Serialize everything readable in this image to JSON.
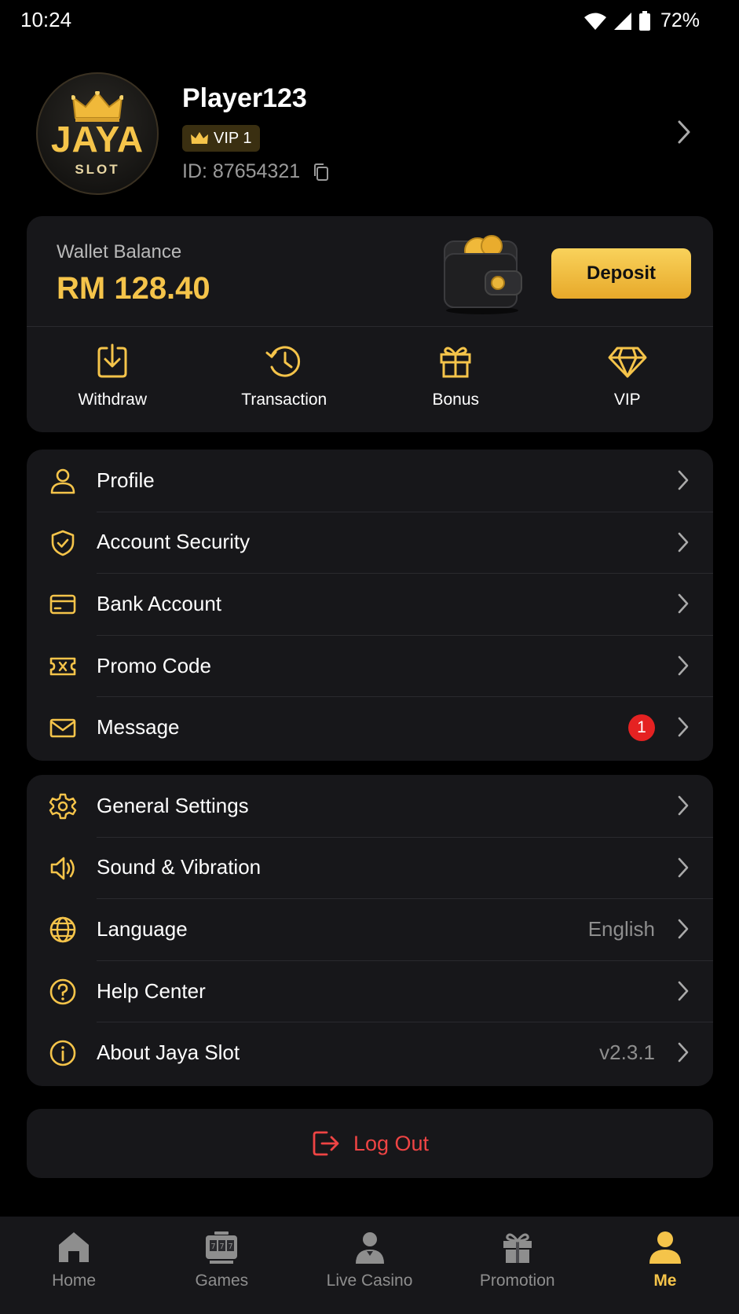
{
  "status_bar": {
    "time": "10:24",
    "battery": "72%"
  },
  "profile": {
    "logo_title": "JAYA",
    "logo_subtitle": "SLOT",
    "name": "Player123",
    "vip_level": "VIP 1",
    "id_text": "ID: 87654321"
  },
  "wallet": {
    "label": "Wallet Balance",
    "balance": "RM 128.40",
    "deposit_label": "Deposit",
    "actions": [
      {
        "label": "Withdraw",
        "icon": "withdraw-icon"
      },
      {
        "label": "Transaction",
        "icon": "history-icon"
      },
      {
        "label": "Bonus",
        "icon": "gift-icon"
      },
      {
        "label": "VIP",
        "icon": "diamond-icon"
      }
    ]
  },
  "menu_account": [
    {
      "label": "Profile",
      "icon": "user-icon"
    },
    {
      "label": "Account Security",
      "icon": "shield-icon"
    },
    {
      "label": "Bank Account",
      "icon": "card-icon"
    },
    {
      "label": "Promo Code",
      "icon": "ticket-icon"
    },
    {
      "label": "Message",
      "icon": "mail-icon",
      "badge": "1"
    }
  ],
  "menu_settings": [
    {
      "label": "General Settings",
      "icon": "gear-icon"
    },
    {
      "label": "Sound & Vibration",
      "icon": "speaker-icon"
    },
    {
      "label": "Language",
      "icon": "globe-icon",
      "value": "English"
    },
    {
      "label": "Help Center",
      "icon": "question-icon"
    },
    {
      "label": "About Jaya Slot",
      "icon": "info-icon",
      "value": "v2.3.1"
    }
  ],
  "logout_label": "Log Out",
  "bottom_nav": [
    {
      "label": "Home",
      "icon": "home-icon",
      "active": false
    },
    {
      "label": "Games",
      "icon": "slot-machine-icon",
      "active": false
    },
    {
      "label": "Live Casino",
      "icon": "dealer-icon",
      "active": false
    },
    {
      "label": "Promotion",
      "icon": "gift-icon",
      "active": false
    },
    {
      "label": "Me",
      "icon": "person-icon",
      "active": true
    }
  ],
  "colors": {
    "accent": "#f5c44a",
    "background": "#000000",
    "card": "#17171a",
    "danger": "#ef4444",
    "badge": "#e52222"
  }
}
